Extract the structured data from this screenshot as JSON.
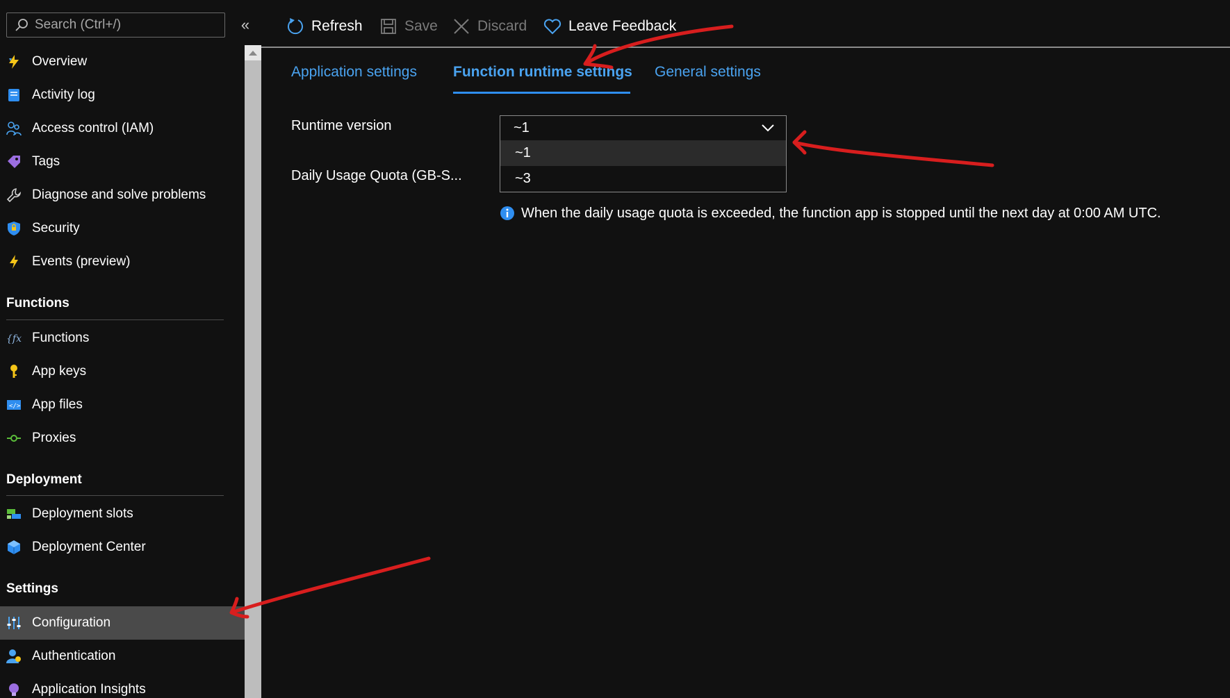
{
  "sidebar": {
    "search_placeholder": "Search (Ctrl+/)",
    "collapse_glyph": "«",
    "items_top": [
      {
        "label": "Overview",
        "icon": "lightning-icon"
      },
      {
        "label": "Activity log",
        "icon": "log-icon"
      },
      {
        "label": "Access control (IAM)",
        "icon": "people-icon"
      },
      {
        "label": "Tags",
        "icon": "tag-icon"
      },
      {
        "label": "Diagnose and solve problems",
        "icon": "wrench-icon"
      },
      {
        "label": "Security",
        "icon": "shield-icon"
      },
      {
        "label": "Events (preview)",
        "icon": "bolt-icon"
      }
    ],
    "sections": [
      {
        "title": "Functions",
        "items": [
          {
            "label": "Functions",
            "icon": "function-icon"
          },
          {
            "label": "App keys",
            "icon": "key-icon"
          },
          {
            "label": "App files",
            "icon": "code-file-icon"
          },
          {
            "label": "Proxies",
            "icon": "proxy-icon"
          }
        ]
      },
      {
        "title": "Deployment",
        "items": [
          {
            "label": "Deployment slots",
            "icon": "slots-icon"
          },
          {
            "label": "Deployment Center",
            "icon": "cube-icon"
          }
        ]
      },
      {
        "title": "Settings",
        "items": [
          {
            "label": "Configuration",
            "icon": "sliders-icon",
            "active": true
          },
          {
            "label": "Authentication",
            "icon": "user-icon"
          },
          {
            "label": "Application Insights",
            "icon": "lightbulb-icon"
          }
        ]
      }
    ]
  },
  "toolbar": {
    "refresh": "Refresh",
    "save": "Save",
    "discard": "Discard",
    "feedback": "Leave Feedback"
  },
  "tabs": [
    {
      "label": "Application settings",
      "active": false
    },
    {
      "label": "Function runtime settings",
      "active": true
    },
    {
      "label": "General settings",
      "active": false
    }
  ],
  "form": {
    "runtime_label": "Runtime version",
    "runtime_value": "~1",
    "runtime_options": [
      "~1",
      "~3"
    ],
    "quota_label": "Daily Usage Quota (GB-S...",
    "info_text": "When the daily usage quota is exceeded, the function app is stopped until the next day at 0:00 AM UTC."
  },
  "colors": {
    "accent": "#2f8ef0",
    "link": "#4aa3f0",
    "annotation": "#d81e1e",
    "background": "#111111"
  }
}
